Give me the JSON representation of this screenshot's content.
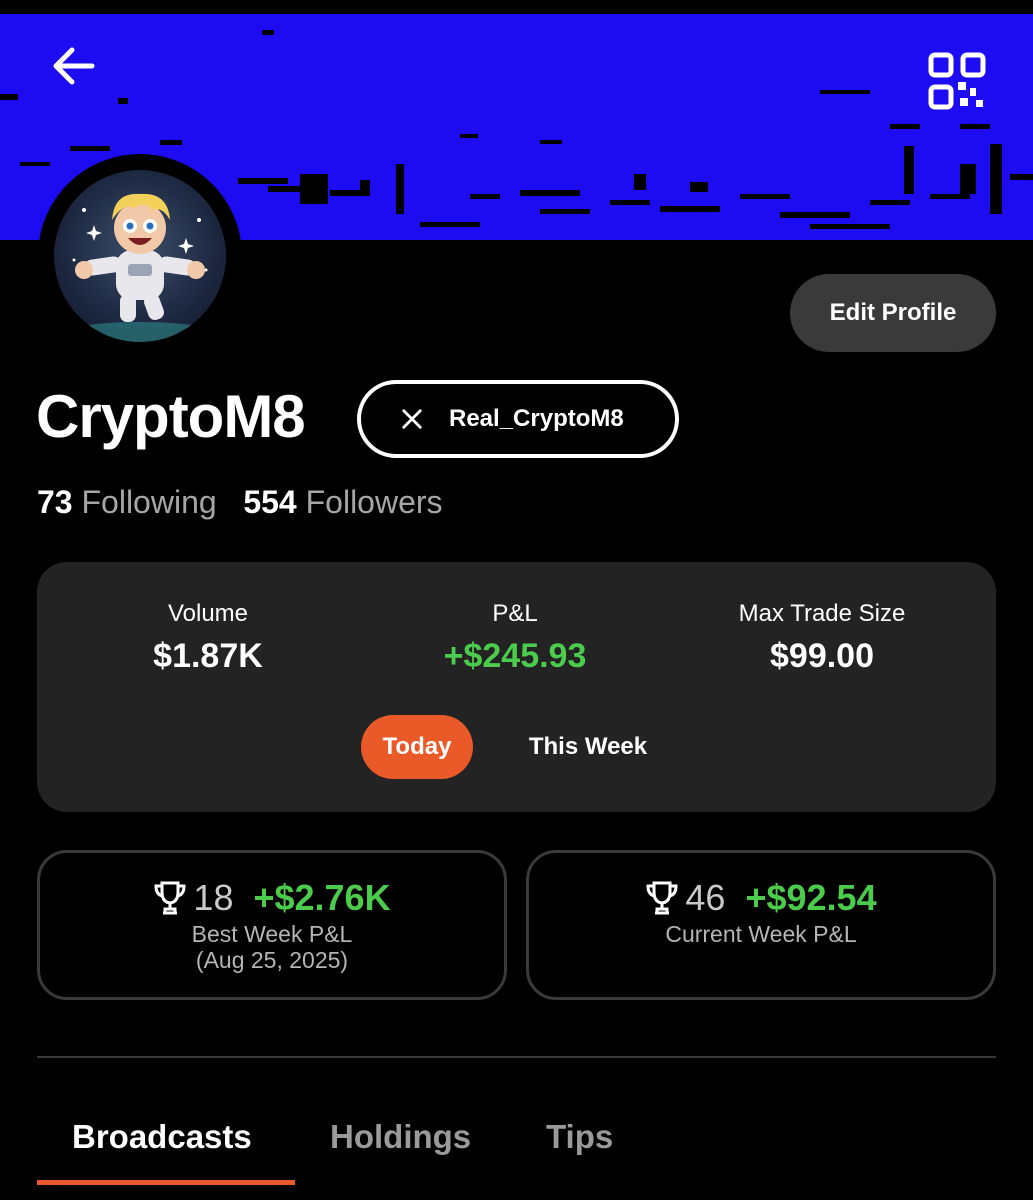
{
  "header": {
    "back_icon": "arrow-left-icon",
    "qr_icon": "qr-code-icon",
    "banner_color": "#1d0bf2"
  },
  "profile": {
    "username": "CryptoM8",
    "edit_label": "Edit Profile",
    "x_handle": "Real_CryptoM8",
    "following_count": "73",
    "following_label": "Following",
    "followers_count": "554",
    "followers_label": "Followers"
  },
  "stats": {
    "volume_label": "Volume",
    "volume_value": "$1.87K",
    "pnl_label": "P&L",
    "pnl_value": "+$245.93",
    "max_trade_label": "Max Trade Size",
    "max_trade_value": "$99.00",
    "period_today": "Today",
    "period_week": "This Week",
    "accent_color": "#ea5a28",
    "positive_color": "#4ccc4c"
  },
  "best_week": {
    "rank": "18",
    "amount": "+$2.76K",
    "label": "Best Week P&L",
    "date": "(Aug 25, 2025)"
  },
  "current_week": {
    "rank": "46",
    "amount": "+$92.54",
    "label": "Current Week P&L"
  },
  "tabs": [
    {
      "label": "Broadcasts",
      "active": true
    },
    {
      "label": "Holdings",
      "active": false
    },
    {
      "label": "Tips",
      "active": false
    }
  ]
}
